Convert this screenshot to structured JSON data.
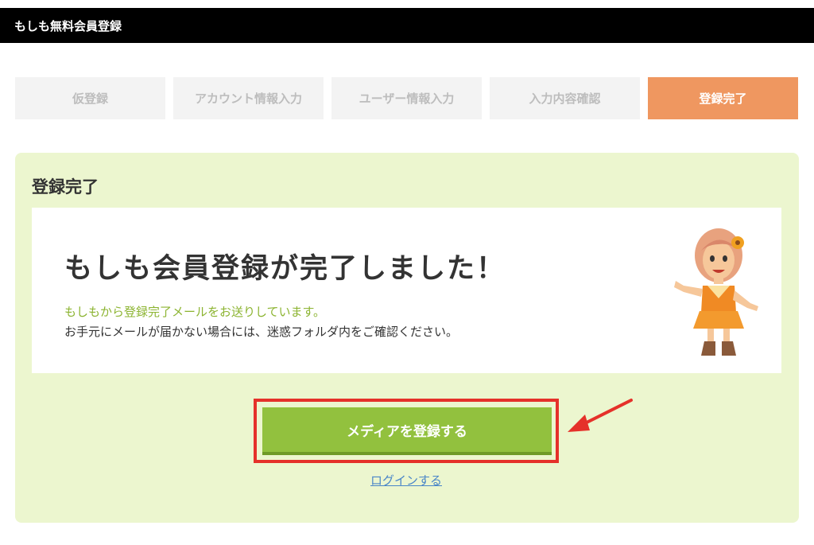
{
  "header": {
    "title": "もしも無料会員登録"
  },
  "steps": [
    {
      "label": "仮登録",
      "active": false
    },
    {
      "label": "アカウント情報入力",
      "active": false
    },
    {
      "label": "ユーザー情報入力",
      "active": false
    },
    {
      "label": "入力内容確認",
      "active": false
    },
    {
      "label": "登録完了",
      "active": true
    }
  ],
  "panel": {
    "title": "登録完了",
    "headline": "もしも会員登録が完了しました！",
    "note_green": "もしもから登録完了メールをお送りしています。",
    "note_dark": "お手元にメールが届かない場合には、迷惑フォルダ内をご確認ください。",
    "primary_button": "メディアを登録する",
    "login_link": "ログインする"
  },
  "colors": {
    "active_step": "#ef9760",
    "panel_bg": "#ecf6cf",
    "button": "#92c13e",
    "highlight": "#e5312a",
    "link": "#4a86c8"
  },
  "icons": {
    "mascot": "mascot-girl-illustration",
    "arrow": "red-pointer-arrow"
  }
}
